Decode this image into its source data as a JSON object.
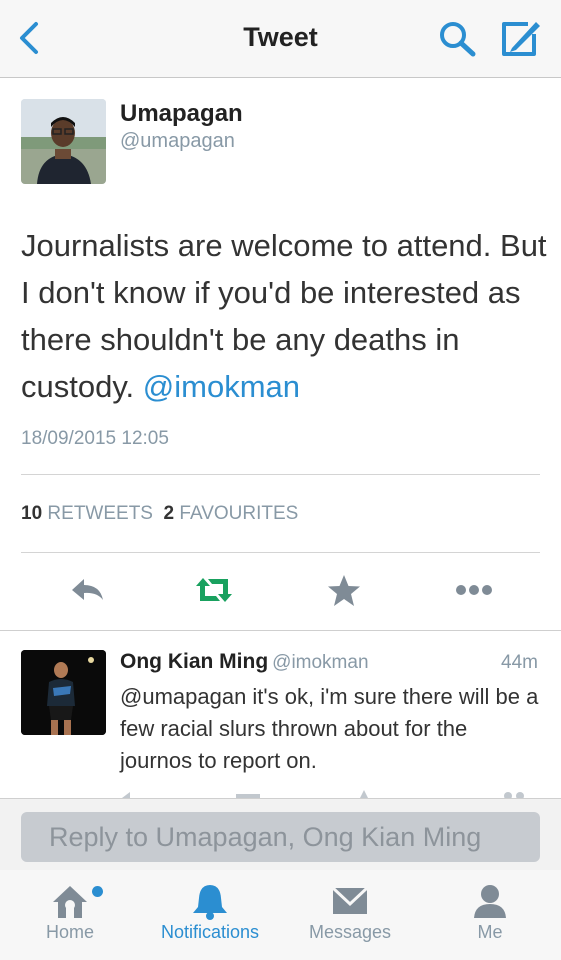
{
  "nav": {
    "title": "Tweet",
    "back_icon": "chevron-left-icon",
    "search_icon": "search-icon",
    "compose_icon": "compose-icon"
  },
  "tweet": {
    "author_name": "Umapagan",
    "author_handle": "@umapagan",
    "text": "Journalists are welcome to attend. But I don't know if you'd be interested as there shouldn't be any deaths in custody.",
    "mention": "@imokman",
    "timestamp": "18/09/2015 12:05",
    "retweet_count": "10",
    "retweet_label": "RETWEETS",
    "favourite_count": "2",
    "favourite_label": "FAVOURITES"
  },
  "reply": {
    "author_name": "Ong Kian Ming",
    "author_handle": "@imokman",
    "time": "44m",
    "text": "@umapagan it's ok, i'm sure there will be a few racial slurs thrown about for the journos to report on."
  },
  "reply_box": {
    "placeholder": "Reply to Umapagan, Ong Kian Ming"
  },
  "tabs": [
    {
      "label": "Home",
      "icon": "home-icon"
    },
    {
      "label": "Notifications",
      "icon": "bell-icon"
    },
    {
      "label": "Messages",
      "icon": "envelope-icon"
    },
    {
      "label": "Me",
      "icon": "person-icon"
    }
  ],
  "colors": {
    "accent": "#2b8ed1",
    "retweet_green": "#19a15f",
    "muted": "#8899a6"
  }
}
